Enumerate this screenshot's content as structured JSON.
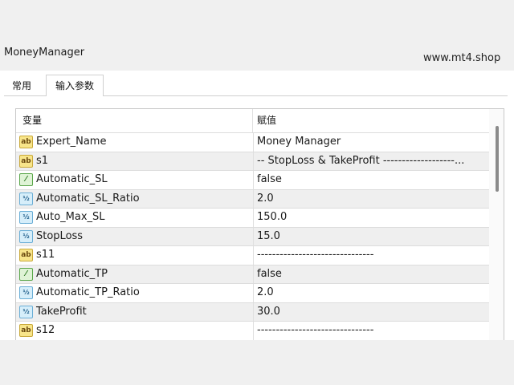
{
  "window": {
    "title": "MoneyManager",
    "site": "www.mt4.shop"
  },
  "tabs": [
    {
      "label": "常用",
      "active": false
    },
    {
      "label": "输入参数",
      "active": true
    }
  ],
  "grid": {
    "headers": {
      "variable": "变量",
      "value": "赋值"
    },
    "rows": [
      {
        "icon": "text-icon",
        "name": "Expert_Name",
        "value": "Money Manager"
      },
      {
        "icon": "text-icon",
        "name": "s1",
        "value": "-- StopLoss & TakeProfit -------------------..."
      },
      {
        "icon": "boolean-icon",
        "name": "Automatic_SL",
        "value": "false"
      },
      {
        "icon": "number-icon",
        "name": "Automatic_SL_Ratio",
        "value": "2.0"
      },
      {
        "icon": "number-icon",
        "name": "Auto_Max_SL",
        "value": "150.0"
      },
      {
        "icon": "number-icon",
        "name": "StopLoss",
        "value": "15.0"
      },
      {
        "icon": "text-icon",
        "name": "s11",
        "value": "-------------------------------"
      },
      {
        "icon": "boolean-icon",
        "name": "Automatic_TP",
        "value": "false"
      },
      {
        "icon": "number-icon",
        "name": "Automatic_TP_Ratio",
        "value": "2.0"
      },
      {
        "icon": "number-icon",
        "name": "TakeProfit",
        "value": "30.0"
      },
      {
        "icon": "text-icon",
        "name": "s12",
        "value": "-------------------------------"
      }
    ]
  },
  "icon_glyphs": {
    "text-icon": "ab",
    "number-icon": "½",
    "boolean-icon": "⁄"
  },
  "colors": {
    "row_alt": "#efefef",
    "panel_bg": "#f0f0f0",
    "grid_border": "#c8c8c8"
  }
}
